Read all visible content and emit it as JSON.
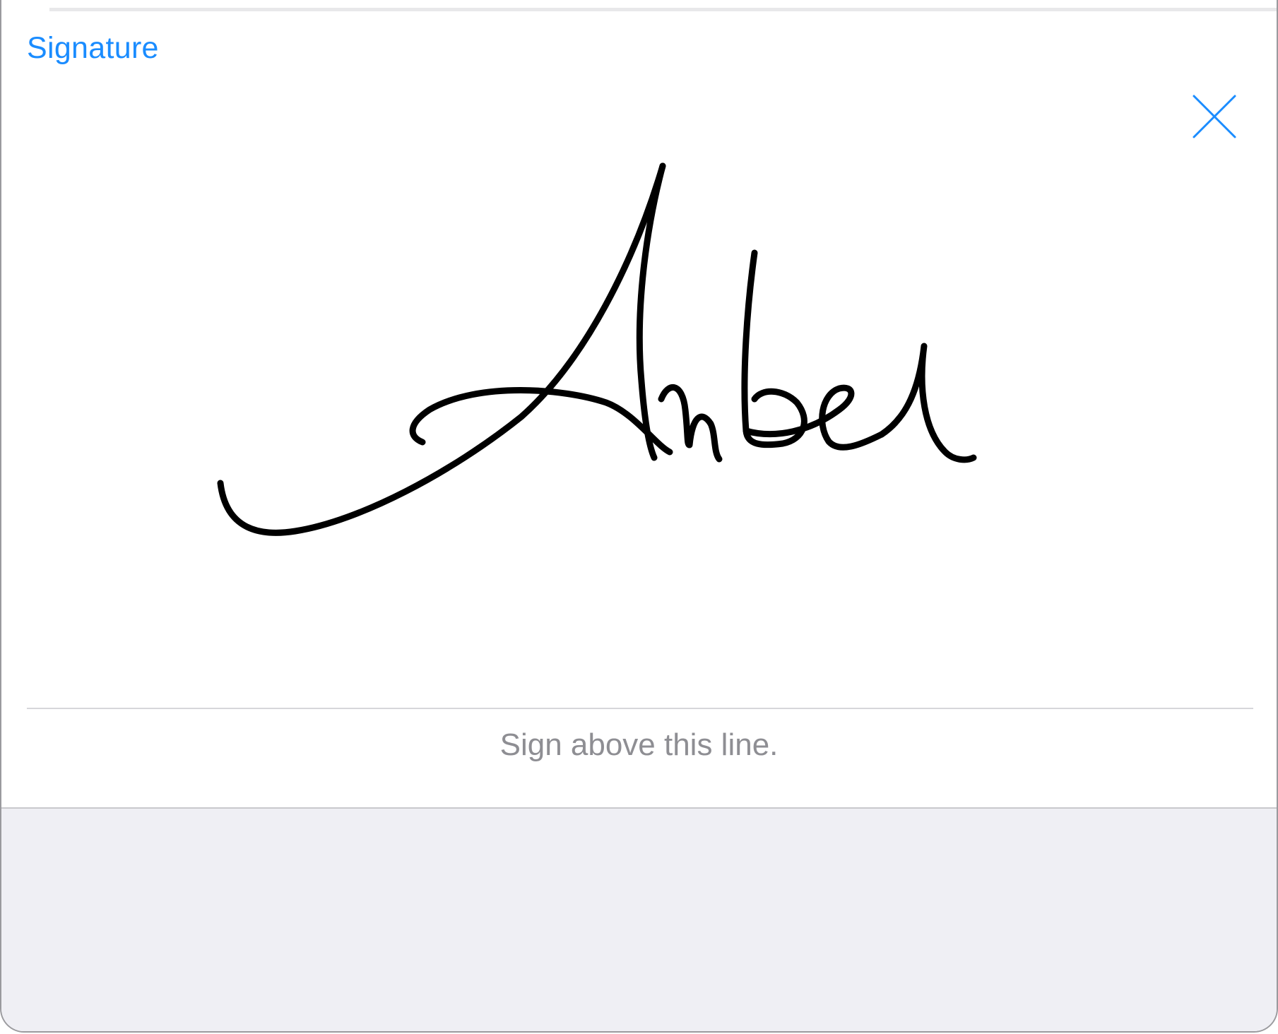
{
  "header": {
    "title": "Signature"
  },
  "close_button": {
    "icon": "close-icon",
    "color": "#1a8cff"
  },
  "signature_area": {
    "hint_text": "Sign above this line.",
    "ink_color": "#000000"
  },
  "colors": {
    "accent": "#1a8cff",
    "hint": "#8e8e93",
    "footer_background": "#efeff4"
  }
}
